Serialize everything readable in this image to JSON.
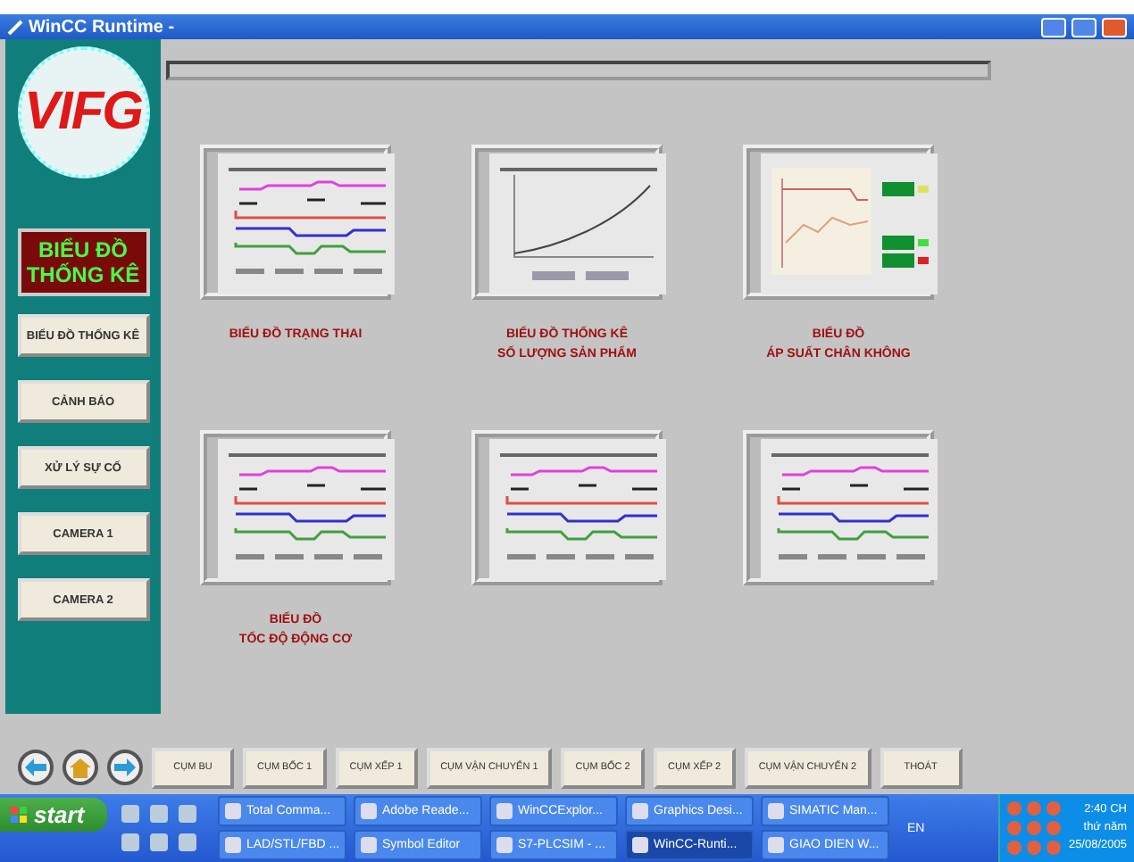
{
  "window": {
    "title": "WinCC Runtime -"
  },
  "sidebar": {
    "logo": "VIFG",
    "title": [
      "BIỂU ĐỒ",
      "THỐNG KÊ"
    ],
    "buttons": [
      {
        "label": "BIỂU ĐỒ THỐNG KÊ"
      },
      {
        "label": "CẢNH BÁO"
      },
      {
        "label": "XỬ LÝ SỰ CỐ"
      },
      {
        "label": "CAMERA 1"
      },
      {
        "label": "CAMERA 2"
      }
    ]
  },
  "tiles": [
    {
      "kind": "trend",
      "caption": [
        "BIỂU ĐỒ TRẠNG THAI"
      ]
    },
    {
      "kind": "curve",
      "caption": [
        "BIỂU ĐỒ THỐNG KÊ",
        "SỐ LƯỢNG SẢN PHẨM"
      ]
    },
    {
      "kind": "pressure",
      "caption": [
        "BIỂU ĐỒ",
        "ÁP SUẤT CHÂN KHÔNG"
      ]
    },
    {
      "kind": "trend",
      "caption": [
        "BIỂU ĐỒ",
        "TỐC ĐỘ ĐỘNG CƠ"
      ]
    },
    {
      "kind": "trend"
    },
    {
      "kind": "trend"
    }
  ],
  "nav_buttons": [
    "CỤM BU",
    "CỤM BỐC 1",
    "CỤM XẾP 1",
    "CỤM VẬN CHUYỂN 1",
    "CỤM BỐC 2",
    "CỤM XẾP 2",
    "CỤM VẬN CHUYỂN 2",
    "THOÁT"
  ],
  "taskbar": {
    "start": "start",
    "tasks": [
      {
        "label": "Total Comma...",
        "selected": false
      },
      {
        "label": "Adobe Reade...",
        "selected": false
      },
      {
        "label": "WinCCExplor...",
        "selected": false
      },
      {
        "label": "Graphics Desi...",
        "selected": false
      },
      {
        "label": "SIMATIC Man...",
        "selected": false
      },
      {
        "label": "LAD/STL/FBD ...",
        "selected": false
      },
      {
        "label": "Symbol Editor",
        "selected": false
      },
      {
        "label": "S7-PLCSIM - ...",
        "selected": false
      },
      {
        "label": "WinCC-Runti...",
        "selected": true
      },
      {
        "label": "GIAO DIEN W...",
        "selected": false
      }
    ],
    "language": "EN",
    "time": "2:40 CH",
    "day": "thứ năm",
    "date": "25/08/2005"
  }
}
